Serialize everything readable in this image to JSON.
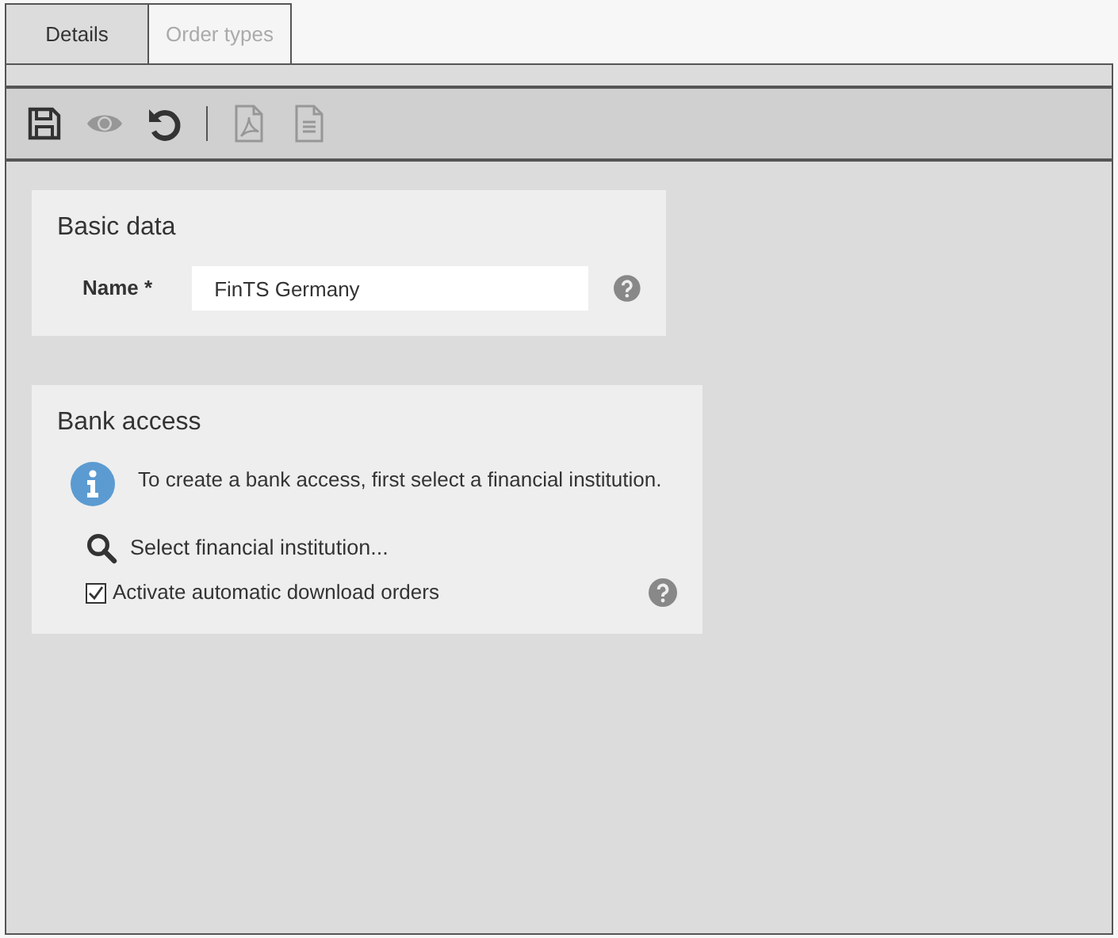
{
  "tabs": [
    {
      "label": "Details",
      "selected": true
    },
    {
      "label": "Order types",
      "selected": false
    }
  ],
  "toolbar": [
    {
      "kind": "save",
      "disabled": false
    },
    {
      "kind": "view",
      "disabled": true
    },
    {
      "kind": "undo",
      "disabled": false
    },
    {
      "kind": "separator"
    },
    {
      "kind": "pdf",
      "disabled": true
    },
    {
      "kind": "document",
      "disabled": true
    }
  ],
  "basic_data": {
    "title": "Basic data",
    "name_label": "Name *",
    "name_value": "FinTS Germany"
  },
  "bank_access": {
    "title": "Bank access",
    "info": "To create a bank access, first select a financial institution.",
    "select_link": "Select financial institution...",
    "auto_download": {
      "label": "Activate automatic download orders",
      "checked": true
    }
  }
}
